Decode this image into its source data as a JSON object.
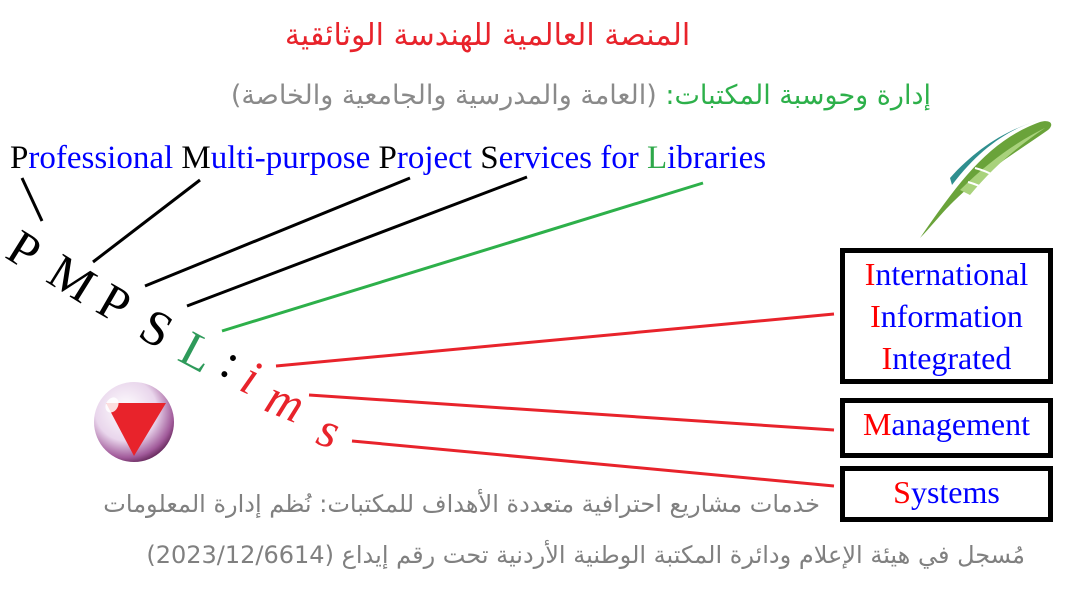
{
  "header": {
    "title": "المنصة العالمية للهندسة الوثائقية",
    "subtitle_lead": "إدارة وحوسبة المكتبات:",
    "subtitle_rest": " (العامة والمدرسية والجامعية والخاصة)"
  },
  "expansion": [
    {
      "initial": "P",
      "rest": "rofessional "
    },
    {
      "initial": "M",
      "rest": "ulti-purpose "
    },
    {
      "initial": "P",
      "rest": "roject "
    },
    {
      "initial": "S",
      "rest": "ervices for "
    },
    {
      "initial": "L",
      "rest": "ibraries"
    }
  ],
  "acronym": {
    "letters": [
      "P",
      "M",
      "P",
      "S",
      "L",
      ":",
      "i",
      "m",
      "s"
    ]
  },
  "boxes": {
    "iii": [
      {
        "initial": "I",
        "rest": "nternational"
      },
      {
        "initial": "I",
        "rest": "nformation"
      },
      {
        "initial": "I",
        "rest": "ntegrated"
      }
    ],
    "management": {
      "initial": "M",
      "rest": "anagement"
    },
    "systems": {
      "initial": "S",
      "rest": "ystems"
    }
  },
  "footer": {
    "line1": "خدمات مشاريع احترافية متعددة الأهداف للمكتبات: نُظم إدارة المعلومات",
    "line2": "مُسجل في هيئة الإعلام ودائرة المكتبة الوطنية الأردنية تحت رقم إيداع (2023/12/6614)"
  },
  "colors": {
    "title": "#e8232b",
    "accent_green": "#2db04a",
    "blue": "#0000ff",
    "red": "#ff0000",
    "gray": "#808080"
  },
  "icons": [
    "quill-feather-icon",
    "red-triangle-orb-icon"
  ]
}
